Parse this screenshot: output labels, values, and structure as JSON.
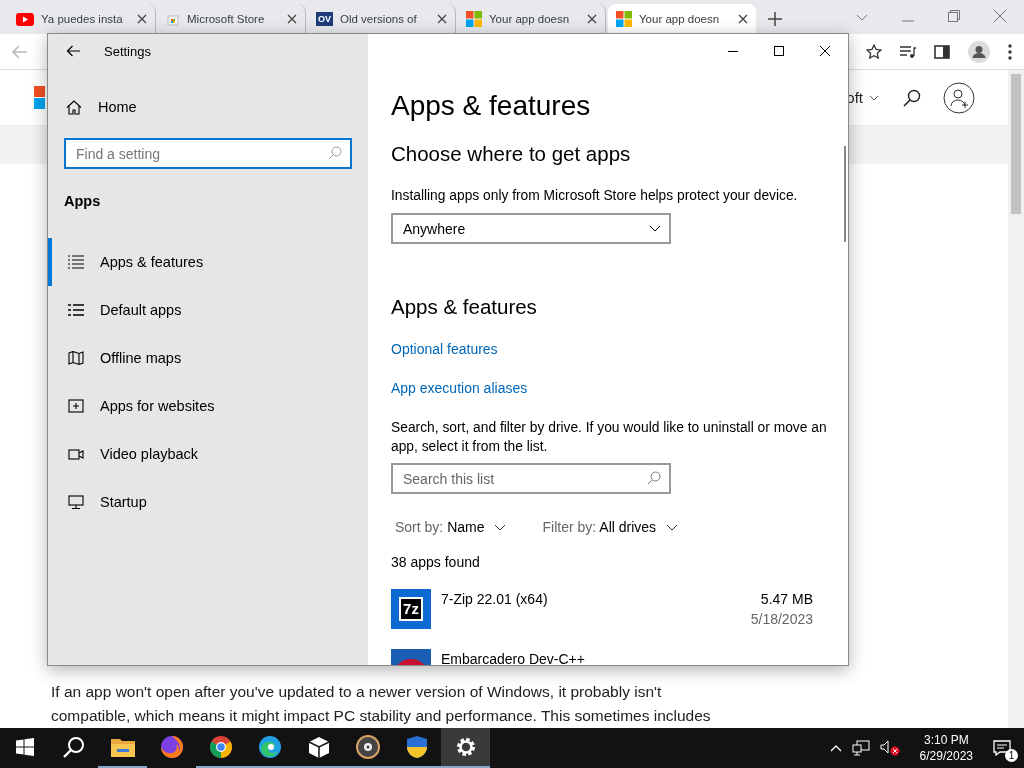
{
  "browser": {
    "tabs": [
      {
        "title": "Ya puedes insta",
        "selected": false
      },
      {
        "title": "Microsoft Store",
        "selected": false
      },
      {
        "title": "Old versions of",
        "selected": false
      },
      {
        "title": "Your app doesn",
        "selected": false
      },
      {
        "title": "Your app doesn",
        "selected": true
      }
    ],
    "tab_badge": "OV",
    "page": {
      "header_text": "oft",
      "paragraph_lines": [
        "If an app won't open after you've updated to a newer version of Windows, it probably isn't",
        "compatible, which means it might impact PC stability and performance. This sometimes includes"
      ]
    }
  },
  "settings": {
    "title": "Settings",
    "home": "Home",
    "search": {
      "placeholder": "Find a setting"
    },
    "section": "Apps",
    "nav": [
      {
        "label": "Apps & features",
        "selected": true
      },
      {
        "label": "Default apps",
        "selected": false
      },
      {
        "label": "Offline maps",
        "selected": false
      },
      {
        "label": "Apps for websites",
        "selected": false
      },
      {
        "label": "Video playback",
        "selected": false
      },
      {
        "label": "Startup",
        "selected": false
      }
    ],
    "heading": "Apps & features",
    "choose": {
      "heading": "Choose where to get apps",
      "description": "Installing apps only from Microsoft Store helps protect your device.",
      "dropdown": "Anywhere"
    },
    "features": {
      "heading": "Apps & features",
      "links": [
        "Optional features",
        "App execution aliases"
      ],
      "description": "Search, sort, and filter by drive. If you would like to uninstall or move an app, select it from the list.",
      "search": {
        "placeholder": "Search this list"
      },
      "sort": {
        "label": "Sort by:",
        "value": "Name"
      },
      "filter": {
        "label": "Filter by:",
        "value": "All drives"
      },
      "count": "38 apps found",
      "apps": [
        {
          "name": "7-Zip 22.01 (x64)",
          "size": "5.47 MB",
          "date": "5/18/2023",
          "icon_text": "7z"
        },
        {
          "name": "Embarcadero Dev-C++"
        }
      ]
    }
  },
  "taskbar": {
    "apps": [
      {
        "running": false,
        "selected": false
      },
      {
        "running": false,
        "selected": false
      },
      {
        "running": true,
        "selected": false
      },
      {
        "running": false,
        "selected": false
      },
      {
        "running": true,
        "selected": false
      },
      {
        "running": true,
        "selected": false
      },
      {
        "running": true,
        "selected": false
      },
      {
        "running": true,
        "selected": false
      },
      {
        "running": true,
        "selected": false
      },
      {
        "running": true,
        "selected": true
      }
    ],
    "time": "3:10 PM",
    "date": "6/29/2023",
    "notifications": "1"
  }
}
